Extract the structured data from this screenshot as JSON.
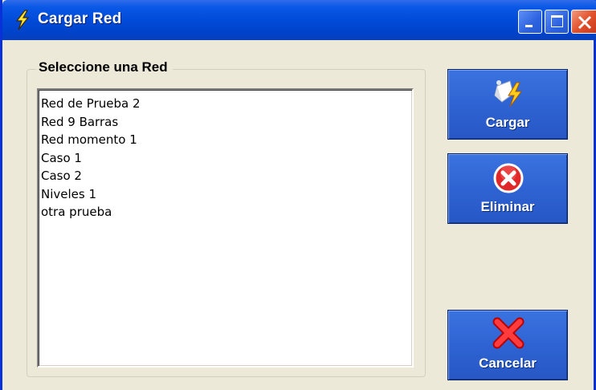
{
  "window": {
    "title": "Cargar Red",
    "title_icon": "lightning-bolt-icon",
    "controls": [
      "minimize-icon",
      "maximize-icon",
      "close-icon"
    ]
  },
  "group": {
    "label": "Seleccione una Red"
  },
  "networks": [
    "Red de Prueba 2",
    "Red 9 Barras",
    "Red momento 1",
    "Caso 1",
    "Caso 2",
    "Niveles 1",
    "otra prueba"
  ],
  "buttons": {
    "load": {
      "label": "Cargar",
      "icon": "load-network-icon"
    },
    "delete": {
      "label": "Eliminar",
      "icon": "error-circle-icon"
    },
    "cancel": {
      "label": "Cancelar",
      "icon": "red-x-icon"
    }
  },
  "colors": {
    "titlebar": "#0049d6",
    "window_bg": "#ece9d8",
    "button_bg": "#2f63d3",
    "close_button": "#e2512c"
  }
}
